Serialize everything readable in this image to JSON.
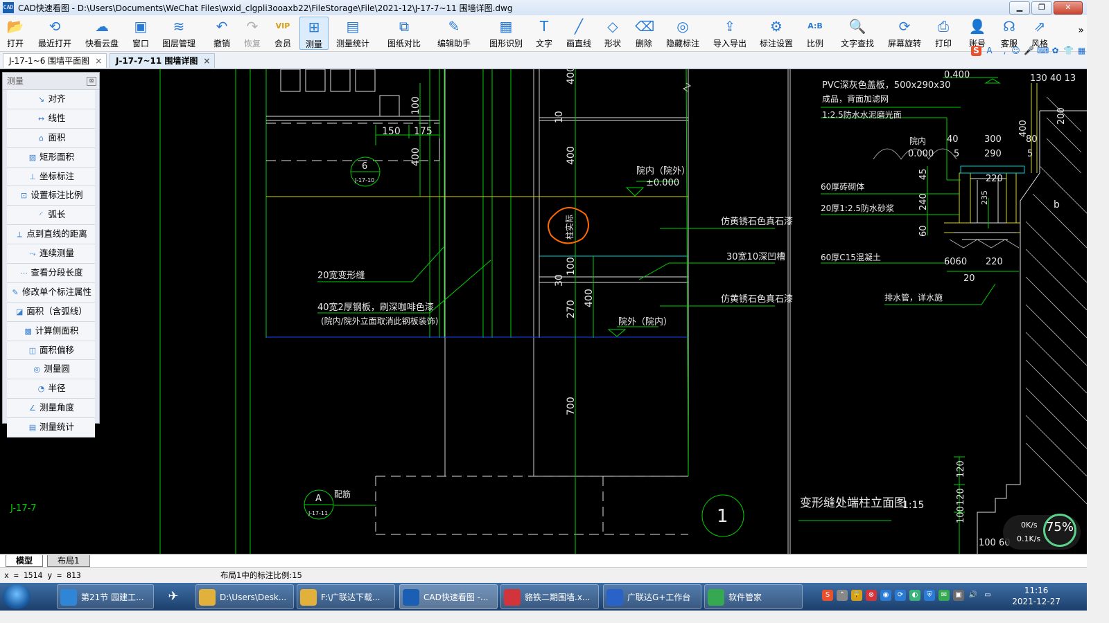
{
  "window": {
    "title": "CAD快速看图 - D:\\Users\\Documents\\WeChat Files\\wxid_clgpli3ooaxb22\\FileStorage\\File\\2021-12\\J-17-7~11 围墙详图.dwg",
    "icon_text": "CAD"
  },
  "toolbar": {
    "items": [
      {
        "label": "打开",
        "icon": "folder-open-icon",
        "glyph": "📂"
      },
      {
        "label": "最近打开",
        "icon": "recent-icon",
        "glyph": "⟲"
      },
      {
        "label": "快看云盘",
        "icon": "cloud-icon",
        "glyph": "☁"
      },
      {
        "label": "窗口",
        "icon": "window-icon",
        "glyph": "▣"
      },
      {
        "label": "图层管理",
        "icon": "layers-icon",
        "glyph": "≋"
      },
      {
        "label": "撤销",
        "icon": "undo-icon",
        "glyph": "↶"
      },
      {
        "label": "恢复",
        "icon": "redo-icon",
        "glyph": "↷"
      },
      {
        "label": "会员",
        "icon": "vip-icon",
        "glyph": "VIP"
      },
      {
        "label": "测量",
        "icon": "measure-icon",
        "glyph": "⊞"
      },
      {
        "label": "测量统计",
        "icon": "measure-stats-icon",
        "glyph": "▤"
      },
      {
        "label": "图纸对比",
        "icon": "compare-icon",
        "glyph": "⧉"
      },
      {
        "label": "编辑助手",
        "icon": "edit-assistant-icon",
        "glyph": "✎"
      },
      {
        "label": "图形识别",
        "icon": "shape-recognition-icon",
        "glyph": "▦"
      },
      {
        "label": "文字",
        "icon": "text-icon",
        "glyph": "T"
      },
      {
        "label": "画直线",
        "icon": "line-icon",
        "glyph": "╱"
      },
      {
        "label": "形状",
        "icon": "shape-icon",
        "glyph": "◇"
      },
      {
        "label": "删除",
        "icon": "eraser-icon",
        "glyph": "⌫"
      },
      {
        "label": "隐藏标注",
        "icon": "hide-annotation-icon",
        "glyph": "◎"
      },
      {
        "label": "导入导出",
        "icon": "import-export-icon",
        "glyph": "⇪"
      },
      {
        "label": "标注设置",
        "icon": "annotation-settings-icon",
        "glyph": "⚙"
      },
      {
        "label": "比例",
        "icon": "scale-icon",
        "glyph": "A:B"
      },
      {
        "label": "文字查找",
        "icon": "text-search-icon",
        "glyph": "🔍"
      },
      {
        "label": "屏幕旋转",
        "icon": "rotate-screen-icon",
        "glyph": "⟳"
      },
      {
        "label": "打印",
        "icon": "print-icon",
        "glyph": "⎙"
      },
      {
        "label": "账号",
        "icon": "account-icon",
        "glyph": "👤"
      },
      {
        "label": "客服",
        "icon": "support-icon",
        "glyph": "☊"
      },
      {
        "label": "风格",
        "icon": "style-icon",
        "glyph": "⇗"
      }
    ],
    "more": "»"
  },
  "tabs": [
    {
      "label": "J-17-1~6 围墙平面图",
      "close": "×"
    },
    {
      "label": "J-17-7~11 围墙详图",
      "close": "×"
    }
  ],
  "measure_panel": {
    "title": "测量",
    "items": [
      "对齐",
      "线性",
      "面积",
      "矩形面积",
      "坐标标注",
      "设置标注比例",
      "弧长",
      "点到直线的距离",
      "连续测量",
      "查看分段长度",
      "修改单个标注属性",
      "面积（含弧线）",
      "计算侧面积",
      "面积偏移",
      "测量圆",
      "半径",
      "测量角度",
      "测量统计"
    ]
  },
  "drawing": {
    "dims": [
      "400",
      "10",
      "400",
      "100",
      "150",
      "175",
      "400",
      "100",
      "30",
      "270",
      "400",
      "700"
    ],
    "bubble_6_top": "6",
    "bubble_6_bottom": "J-17-10",
    "bubble_a_top": "A",
    "bubble_a_bottom": "J-17-11",
    "pei_jin": "配筋",
    "marker_1": "1",
    "drawing_id": "J-17-7",
    "circled_text": "柱实际",
    "level_top": "院内（院外）",
    "level_top_value": "±0.000",
    "level_bottom": "院外（院内）",
    "note_gap": "20宽变形缝",
    "note_plate_1": "40宽2厚钢板，刷深咖啡色漆",
    "note_plate_2": "(院内/院外立面取消此钢板装饰)",
    "note_stone_1": "仿黄锈石色真石漆",
    "note_groove": "30宽10深凹槽",
    "note_stone_2": "仿黄锈石色真石漆",
    "right_notes": [
      "PVC深灰色盖板，500x290x30",
      "成品，背面加滤网",
      "1:2.5防水水泥磨光面",
      "60厚砖砌体",
      "20厚1:2.5防水砂浆",
      "60厚C15混凝土",
      "排水管，详水施"
    ],
    "right_level_label": "院内",
    "right_level_value": "0.000",
    "right_top_level": "0.400",
    "right_dims": [
      "40",
      "300",
      "400",
      "80",
      "5",
      "290",
      "5",
      "45",
      "220",
      "240",
      "235",
      "60",
      "6060",
      "220",
      "20",
      "130 40 13",
      "200",
      "120",
      "120",
      "100",
      "100 60"
    ],
    "letter_b": "b",
    "elevation_title": "变形缝处端柱立面图",
    "elevation_scale": "1:15"
  },
  "layout_tabs": [
    "模型",
    "布局1"
  ],
  "status": {
    "coords": "x = 1514  y = 813",
    "scale_text": "布局1中的标注比例:15"
  },
  "net_widget": {
    "up": "0K/s",
    "down": "0.1K/s",
    "percent": "75%"
  },
  "taskbar": {
    "tasks": [
      {
        "label": "第21节 园建工...",
        "color": "#2f86d6"
      },
      {
        "label": "D:\\Users\\Desk...",
        "color": "#e2b13c"
      },
      {
        "label": "F:\\广联达下载...",
        "color": "#e2b13c"
      },
      {
        "label": "CAD快速看图 -...",
        "color": "#1b5fb5"
      },
      {
        "label": "貉铁二期围墙.x...",
        "color": "#d1343a"
      },
      {
        "label": "广联达G+工作台",
        "color": "#2a63c7"
      },
      {
        "label": "软件管家",
        "color": "#36a852"
      }
    ],
    "time": "11:16",
    "date": "2021-12-27"
  }
}
